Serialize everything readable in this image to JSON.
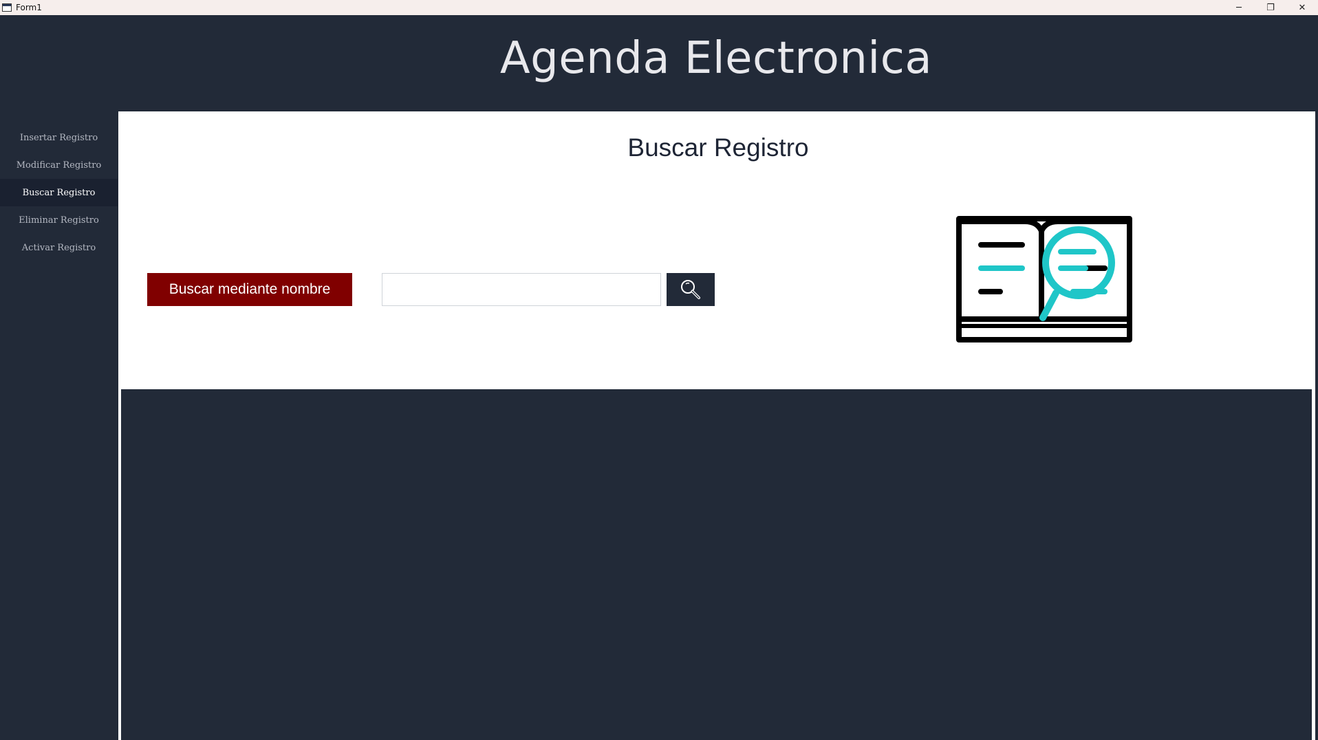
{
  "window": {
    "title": "Form1",
    "controls": [
      "─",
      "❐",
      "✕"
    ]
  },
  "header": {
    "title": "Agenda Electronica"
  },
  "sidebar": {
    "items": [
      {
        "label": "Insertar Registro"
      },
      {
        "label": "Modificar Registro"
      },
      {
        "label": "Buscar Registro"
      },
      {
        "label": "Eliminar Registro"
      },
      {
        "label": "Activar Registro"
      }
    ],
    "active_index": 2
  },
  "main": {
    "title": "Buscar Registro",
    "search_mode_label": "Buscar mediante nombre",
    "search_value": "",
    "search_icon": "magnifier-icon",
    "illustration_icon": "book-search-icon"
  },
  "colors": {
    "background": "#222a38",
    "accent_button": "#800000",
    "illustration_accent": "#1fc6c8",
    "panel": "#ffffff"
  }
}
